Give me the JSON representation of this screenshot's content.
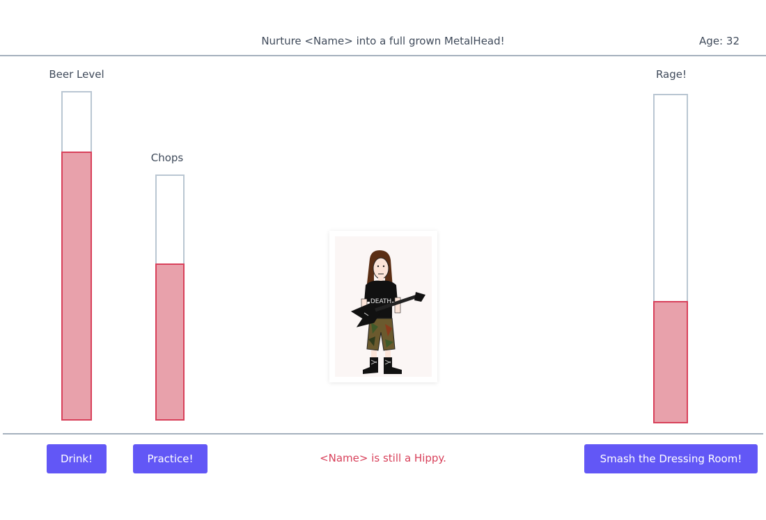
{
  "header": {
    "title": "Nurture <Name> into a full grown MetalHead!",
    "age_label": "Age:",
    "age_value": "32"
  },
  "meters": {
    "beer": {
      "label": "Beer Level",
      "level_percent": 82
    },
    "chops": {
      "label": "Chops",
      "level_percent": 64
    },
    "rage": {
      "label": "Rage!",
      "level_percent": 37
    }
  },
  "character": {
    "description_icon": "metalhead-guitarist-drawing",
    "shirt_text": "DEATH"
  },
  "actions": {
    "drink_label": "Drink!",
    "practice_label": "Practice!",
    "smash_label": "Smash the Dressing Room!"
  },
  "status": {
    "message": "<Name> is still a Hippy."
  },
  "colors": {
    "accent": "#6257f6",
    "meter_fill": "#e8a1ab",
    "meter_border": "#d8405a",
    "status_text": "#d8405a"
  }
}
